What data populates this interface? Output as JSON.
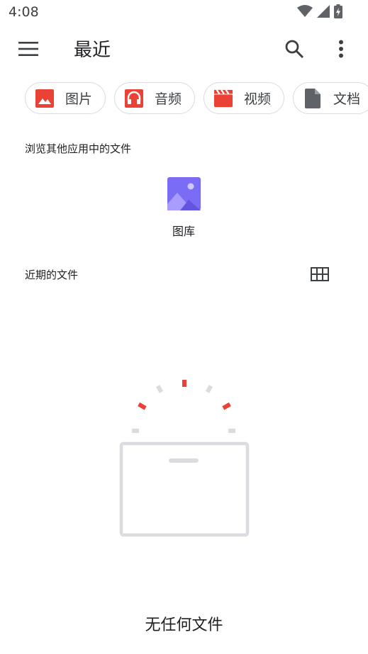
{
  "status_bar": {
    "time": "4:08",
    "icons": [
      "wifi-icon",
      "signal-icon",
      "battery-charging-icon"
    ]
  },
  "app_bar": {
    "title": "最近",
    "icons": [
      "menu-icon",
      "search-icon",
      "more-vert-icon"
    ]
  },
  "chips": [
    {
      "label": "图片",
      "icon": "image-icon",
      "color": "#ea4335"
    },
    {
      "label": "音频",
      "icon": "headphones-icon",
      "color": "#ea4335"
    },
    {
      "label": "视频",
      "icon": "clapperboard-icon",
      "color": "#ea4335"
    },
    {
      "label": "文档",
      "icon": "document-icon",
      "color": "#5f6368"
    }
  ],
  "browse_section": {
    "label": "浏览其他应用中的文件",
    "apps": [
      {
        "label": "图库",
        "icon": "gallery-icon",
        "color": "#7b6cf6"
      }
    ]
  },
  "recent_section": {
    "label": "近期的文件",
    "view_toggle_icon": "grid-view-icon"
  },
  "empty_state": {
    "text": "无任何文件",
    "accent_color": "#ea4335"
  }
}
